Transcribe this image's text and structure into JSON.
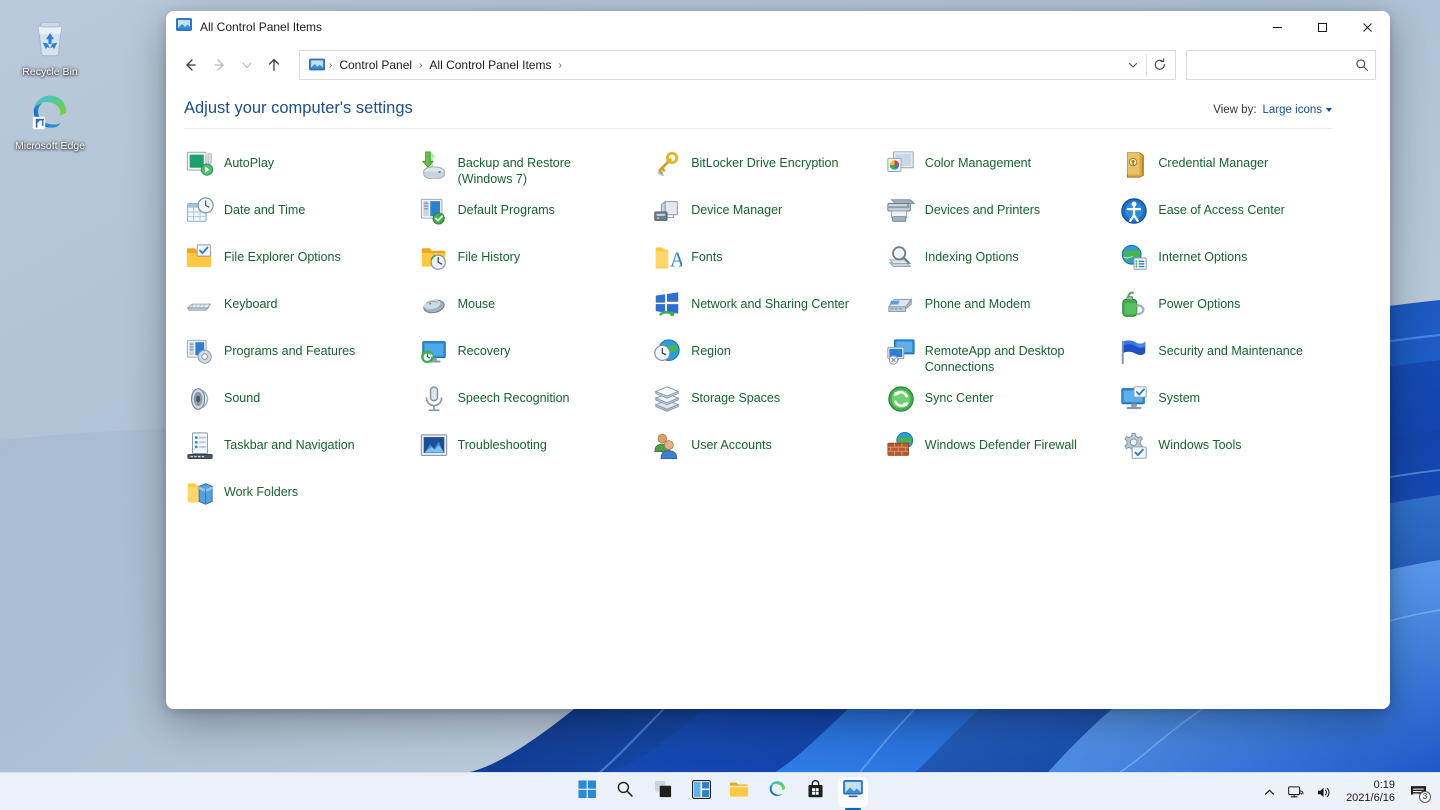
{
  "desktop": {
    "icons": [
      {
        "name": "recycle-bin",
        "label": "Recycle Bin"
      },
      {
        "name": "microsoft-edge",
        "label": "Microsoft Edge"
      }
    ]
  },
  "window": {
    "title": "All Control Panel Items",
    "controls": {
      "minimize": "Minimize",
      "maximize": "Maximize",
      "close": "Close"
    },
    "nav": {
      "back": "Back",
      "forward": "Forward",
      "recent": "Recent locations",
      "up": "Up"
    },
    "breadcrumb": {
      "items": [
        "Control Panel",
        "All Control Panel Items"
      ],
      "separator": "›"
    },
    "address_actions": {
      "dropdown": "Previous locations",
      "refresh": "Refresh"
    },
    "search": {
      "value": "",
      "placeholder": ""
    }
  },
  "content": {
    "page_title": "Adjust your computer's settings",
    "view_by": {
      "label": "View by:",
      "value": "Large icons"
    },
    "items": [
      {
        "icon": "autoplay-icon",
        "label": "AutoPlay"
      },
      {
        "icon": "backup-restore-icon",
        "label": "Backup and Restore (Windows 7)"
      },
      {
        "icon": "bitlocker-icon",
        "label": "BitLocker Drive Encryption"
      },
      {
        "icon": "color-management-icon",
        "label": "Color Management"
      },
      {
        "icon": "credential-manager-icon",
        "label": "Credential Manager"
      },
      {
        "icon": "date-time-icon",
        "label": "Date and Time"
      },
      {
        "icon": "default-programs-icon",
        "label": "Default Programs"
      },
      {
        "icon": "device-manager-icon",
        "label": "Device Manager"
      },
      {
        "icon": "devices-printers-icon",
        "label": "Devices and Printers"
      },
      {
        "icon": "ease-of-access-icon",
        "label": "Ease of Access Center"
      },
      {
        "icon": "file-explorer-options-icon",
        "label": "File Explorer Options"
      },
      {
        "icon": "file-history-icon",
        "label": "File History"
      },
      {
        "icon": "fonts-icon",
        "label": "Fonts"
      },
      {
        "icon": "indexing-options-icon",
        "label": "Indexing Options"
      },
      {
        "icon": "internet-options-icon",
        "label": "Internet Options"
      },
      {
        "icon": "keyboard-icon",
        "label": "Keyboard"
      },
      {
        "icon": "mouse-icon",
        "label": "Mouse"
      },
      {
        "icon": "network-sharing-icon",
        "label": "Network and Sharing Center"
      },
      {
        "icon": "phone-modem-icon",
        "label": "Phone and Modem"
      },
      {
        "icon": "power-options-icon",
        "label": "Power Options"
      },
      {
        "icon": "programs-features-icon",
        "label": "Programs and Features"
      },
      {
        "icon": "recovery-icon",
        "label": "Recovery"
      },
      {
        "icon": "region-icon",
        "label": "Region"
      },
      {
        "icon": "remoteapp-icon",
        "label": "RemoteApp and Desktop Connections"
      },
      {
        "icon": "security-maintenance-icon",
        "label": "Security and Maintenance"
      },
      {
        "icon": "sound-icon",
        "label": "Sound"
      },
      {
        "icon": "speech-recognition-icon",
        "label": "Speech Recognition"
      },
      {
        "icon": "storage-spaces-icon",
        "label": "Storage Spaces"
      },
      {
        "icon": "sync-center-icon",
        "label": "Sync Center"
      },
      {
        "icon": "system-icon",
        "label": "System"
      },
      {
        "icon": "taskbar-navigation-icon",
        "label": "Taskbar and Navigation"
      },
      {
        "icon": "troubleshooting-icon",
        "label": "Troubleshooting"
      },
      {
        "icon": "user-accounts-icon",
        "label": "User Accounts"
      },
      {
        "icon": "windows-defender-firewall-icon",
        "label": "Windows Defender Firewall"
      },
      {
        "icon": "windows-tools-icon",
        "label": "Windows Tools"
      },
      {
        "icon": "work-folders-icon",
        "label": "Work Folders"
      }
    ]
  },
  "taskbar": {
    "buttons": [
      {
        "name": "start-button",
        "label": "Start"
      },
      {
        "name": "search-button",
        "label": "Search"
      },
      {
        "name": "task-view-button",
        "label": "Task View"
      },
      {
        "name": "widgets-button",
        "label": "Widgets"
      },
      {
        "name": "file-explorer-button",
        "label": "File Explorer"
      },
      {
        "name": "microsoft-edge-button",
        "label": "Microsoft Edge"
      },
      {
        "name": "microsoft-store-button",
        "label": "Microsoft Store"
      },
      {
        "name": "control-panel-button",
        "label": "Control Panel"
      }
    ],
    "tray": {
      "show_hidden": "Show hidden icons",
      "network": "Network",
      "volume": "Volume",
      "time": "0:19",
      "date": "2021/6/16",
      "notifications_count": "3"
    }
  },
  "colors": {
    "link_green": "#16632f",
    "title_blue": "#1c4e8a",
    "accent": "#0067c0",
    "close_hover": "#e81123"
  }
}
